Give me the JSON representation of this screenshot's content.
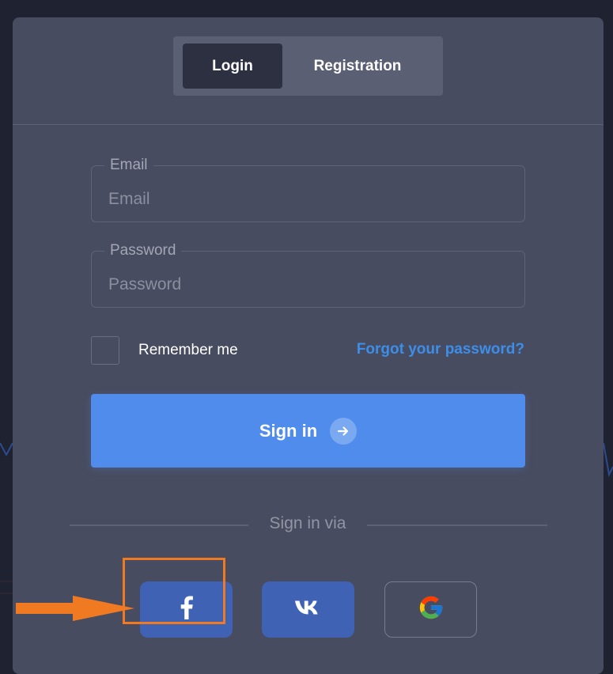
{
  "tabs": [
    {
      "label": "Login",
      "active": true
    },
    {
      "label": "Registration",
      "active": false
    }
  ],
  "form": {
    "email": {
      "label": "Email",
      "placeholder": "Email",
      "value": ""
    },
    "password": {
      "label": "Password",
      "placeholder": "Password",
      "value": ""
    },
    "remember_label": "Remember me",
    "remember_checked": false,
    "forgot_label": "Forgot your password?",
    "submit_label": "Sign in",
    "submit_icon": "arrow-right-icon"
  },
  "sign_in_via": "Sign in via",
  "social": [
    {
      "name": "facebook",
      "icon": "facebook-icon",
      "highlighted": true
    },
    {
      "name": "vk",
      "icon": "vk-icon"
    },
    {
      "name": "google",
      "icon": "google-icon"
    }
  ],
  "colors": {
    "background": "#1f2230",
    "card": "#484c60",
    "primary": "#4f8cec",
    "link": "#3d8ee8",
    "social": "#3f62b5",
    "annotation": "#f07a22"
  }
}
